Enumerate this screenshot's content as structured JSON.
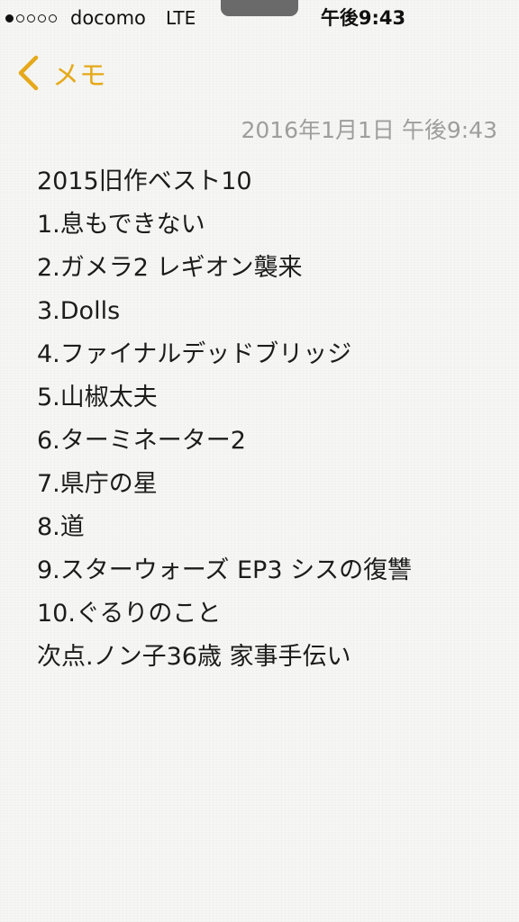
{
  "status_bar": {
    "signal_filled": 1,
    "signal_total": 5,
    "carrier": "docomo",
    "network": "LTE",
    "time": "午後9:43"
  },
  "nav": {
    "back_icon": "chevron-left-icon",
    "back_label": "メモ"
  },
  "colors": {
    "accent": "#e5a91a",
    "timestamp": "#9e9e9e",
    "text": "#1c1c1c",
    "paper": "#f6f6f4"
  },
  "note": {
    "timestamp": "2016年1月1日 午後9:43",
    "lines": [
      "2015旧作ベスト10",
      "1.息もできない",
      "2.ガメラ2 レギオン襲来",
      "3.Dolls",
      "4.ファイナルデッドブリッジ",
      "5.山椒太夫",
      "6.ターミネーター2",
      "7.県庁の星",
      "8.道",
      "9.スターウォーズ EP3 シスの復讐",
      "10.ぐるりのこと",
      "次点.ノン子36歳 家事手伝い"
    ]
  }
}
